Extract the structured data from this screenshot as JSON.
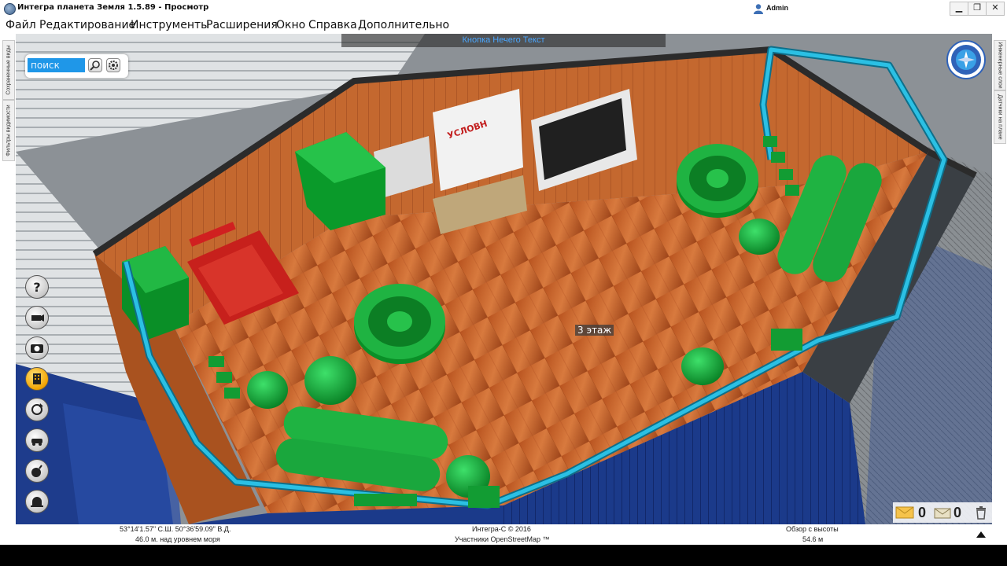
{
  "window": {
    "title": "Интегра планета Земля 1.5.89 - Просмотр",
    "user": "Admin",
    "controls": {
      "minimize": "▁",
      "restore": "❐",
      "close": "✕"
    }
  },
  "menu": [
    "Файл",
    "Редактирование",
    "Инструменты",
    "Расширения",
    "Окно",
    "Справка",
    "Дополнительно"
  ],
  "left_tabs": [
    "Сохраненные виды",
    "Фильтры видимости"
  ],
  "right_tabs": [
    "Инженерные слои",
    "Датчики на плане"
  ],
  "search": {
    "placeholder": "поиск"
  },
  "viewport": {
    "floor_banner": "Кнопка Нечего Текст",
    "floor_label": "3 этаж",
    "sign_text": "УСЛОВН"
  },
  "tools": [
    "help-icon",
    "camera-icon",
    "photo-icon",
    "building-icon",
    "rotate-icon",
    "vehicle-icon",
    "bomb-icon",
    "alarm-icon"
  ],
  "messages": {
    "unread": "0",
    "read": "0"
  },
  "status": {
    "coords": "53°14'1.57\" С.Ш. 50°36'59.09\" В.Д.",
    "altitude": "46.0 м. над уровнем моря",
    "copyright": "Интегра-С © 2016",
    "osm": "Участники OpenStreetMap ™",
    "view_label": "Обзор с высоты",
    "view_height": "54.6 м"
  },
  "colors": {
    "accent": "#1f97e8",
    "equipment": "#0a9a2a",
    "pipes": "#1aa3c8",
    "floor": "#c8602a"
  }
}
